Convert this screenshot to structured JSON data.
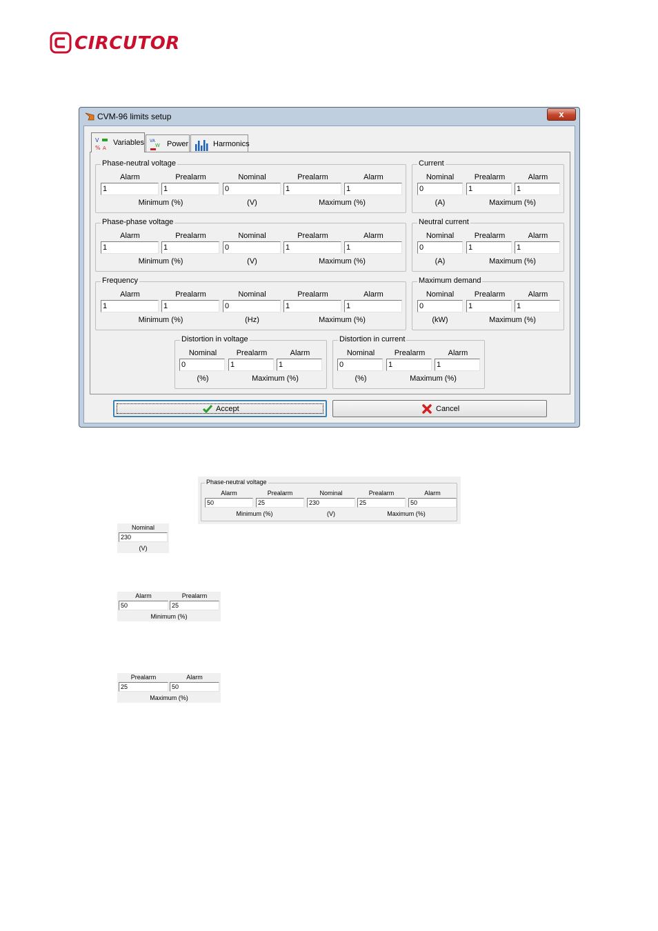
{
  "brand": {
    "name": "CIRCUTOR",
    "color": "#c8102e",
    "logo_icon": "circutor-logo-icon"
  },
  "window": {
    "title": "CVM-96 limits setup",
    "close_label": "x",
    "tabs": [
      {
        "label": "Variables",
        "icon": "variables-icon",
        "active": true
      },
      {
        "label": "Power",
        "icon": "power-icon",
        "active": false
      },
      {
        "label": "Harmonics",
        "icon": "harmonics-icon",
        "active": false
      }
    ],
    "groups": {
      "phase_neutral": {
        "title": "Phase-neutral voltage",
        "headers": [
          "Alarm",
          "Prealarm",
          "Nominal",
          "Prealarm",
          "Alarm"
        ],
        "values": [
          "1",
          "1",
          "0",
          "1",
          "1"
        ],
        "footer": [
          "Minimum (%)",
          "(V)",
          "Maximum (%)"
        ]
      },
      "phase_phase": {
        "title": "Phase-phase voltage",
        "headers": [
          "Alarm",
          "Prealarm",
          "Nominal",
          "Prealarm",
          "Alarm"
        ],
        "values": [
          "1",
          "1",
          "0",
          "1",
          "1"
        ],
        "footer": [
          "Minimum (%)",
          "(V)",
          "Maximum (%)"
        ]
      },
      "frequency": {
        "title": "Frequency",
        "headers": [
          "Alarm",
          "Prealarm",
          "Nominal",
          "Prealarm",
          "Alarm"
        ],
        "values": [
          "1",
          "1",
          "0",
          "1",
          "1"
        ],
        "footer": [
          "Minimum (%)",
          "(Hz)",
          "Maximum (%)"
        ]
      },
      "current": {
        "title": "Current",
        "headers": [
          "Nominal",
          "Prealarm",
          "Alarm"
        ],
        "values": [
          "0",
          "1",
          "1"
        ],
        "footer": [
          "(A)",
          "Maximum (%)"
        ]
      },
      "neutral_current": {
        "title": "Neutral current",
        "headers": [
          "Nominal",
          "Prealarm",
          "Alarm"
        ],
        "values": [
          "0",
          "1",
          "1"
        ],
        "footer": [
          "(A)",
          "Maximum (%)"
        ]
      },
      "max_demand": {
        "title": "Maximum demand",
        "headers": [
          "Nominal",
          "Prealarm",
          "Alarm"
        ],
        "values": [
          "0",
          "1",
          "1"
        ],
        "footer": [
          "(kW)",
          "Maximum (%)"
        ]
      },
      "distortion_voltage": {
        "title": "Distortion in voltage",
        "headers": [
          "Nominal",
          "Prealarm",
          "Alarm"
        ],
        "values": [
          "0",
          "1",
          "1"
        ],
        "footer": [
          "(%)",
          "Maximum (%)"
        ]
      },
      "distortion_current": {
        "title": "Distortion in current",
        "headers": [
          "Nominal",
          "Prealarm",
          "Alarm"
        ],
        "values": [
          "0",
          "1",
          "1"
        ],
        "footer": [
          "(%)",
          "Maximum (%)"
        ]
      }
    },
    "buttons": {
      "accept": {
        "label": "Accept",
        "icon": "checkmark-icon",
        "color": "#2a9d2a"
      },
      "cancel": {
        "label": "Cancel",
        "icon": "red-x-icon",
        "color": "#d02020"
      }
    }
  },
  "example_crops": {
    "phase_neutral": {
      "title": "Phase-neutral voltage",
      "headers": [
        "Alarm",
        "Prealarm",
        "Nominal",
        "Prealarm",
        "Alarm"
      ],
      "values": [
        "50",
        "25",
        "230",
        "25",
        "50"
      ],
      "footer": [
        "Minimum (%)",
        "(V)",
        "Maximum (%)"
      ]
    },
    "nominal": {
      "header": "Nominal",
      "value": "230",
      "footer": "(V)"
    },
    "minimum": {
      "headers": [
        "Alarm",
        "Prealarm"
      ],
      "values": [
        "50",
        "25"
      ],
      "footer": "Minimum (%)"
    },
    "maximum": {
      "headers": [
        "Prealarm",
        "Alarm"
      ],
      "values": [
        "25",
        "50"
      ],
      "footer": "Maximum (%)"
    }
  }
}
